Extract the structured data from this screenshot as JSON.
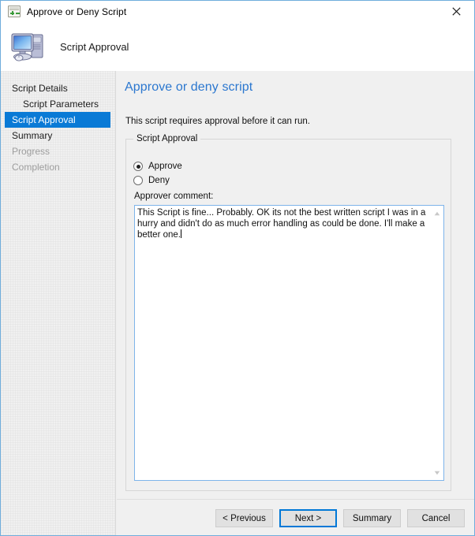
{
  "window": {
    "title": "Approve or Deny Script",
    "title_icon": "approve-deny-icon",
    "close_icon": "close-icon"
  },
  "header": {
    "icon": "computer-icon",
    "title": "Script Approval"
  },
  "sidebar": {
    "items": [
      {
        "label": "Script Details",
        "state": "normal",
        "indent": false
      },
      {
        "label": "Script Parameters",
        "state": "normal",
        "indent": true
      },
      {
        "label": "Script Approval",
        "state": "selected",
        "indent": false
      },
      {
        "label": "Summary",
        "state": "normal",
        "indent": false
      },
      {
        "label": "Progress",
        "state": "disabled",
        "indent": false
      },
      {
        "label": "Completion",
        "state": "disabled",
        "indent": false
      }
    ]
  },
  "main": {
    "heading": "Approve or deny script",
    "description": "This script requires approval before it can run.",
    "group": {
      "title": "Script Approval",
      "options": [
        {
          "label": "Approve",
          "selected": true
        },
        {
          "label": "Deny",
          "selected": false
        }
      ],
      "comment_label": "Approver comment:",
      "comment_value": "This Script is fine... Probably. OK its not the best written script I was in a hurry and didn't do as much error handling as could be done. I'll make a better one.",
      "scrollbar": {
        "up_icon": "scroll-up-arrow-icon",
        "down_icon": "scroll-down-arrow-icon"
      }
    }
  },
  "footer": {
    "buttons": [
      {
        "label": "< Previous",
        "focused": false
      },
      {
        "label": "Next >",
        "focused": true
      },
      {
        "label": "Summary",
        "focused": false
      },
      {
        "label": "Cancel",
        "focused": false
      }
    ]
  },
  "colors": {
    "accent_blue": "#2b77cf",
    "selection_blue": "#0a7ad6",
    "focus_blue": "#0078d7",
    "window_border": "#6faddc",
    "panel_bg": "#f0f0f0"
  }
}
